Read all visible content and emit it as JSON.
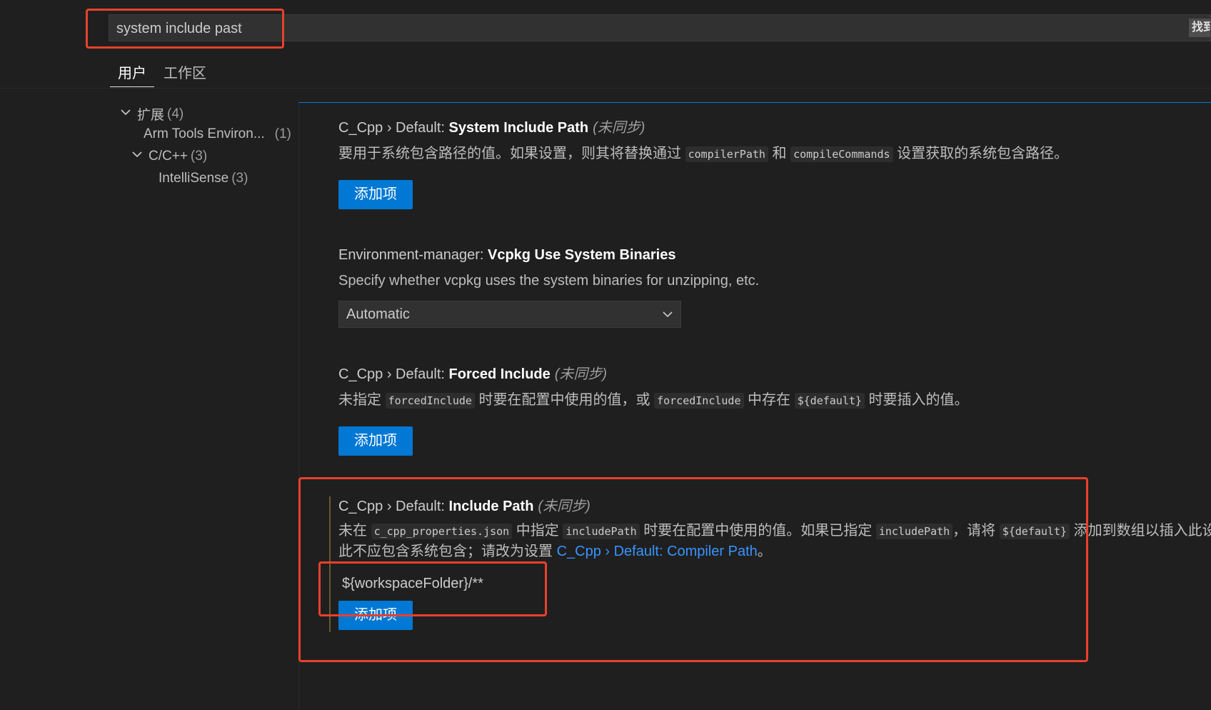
{
  "search": {
    "query": "system include past",
    "find_label": "找到"
  },
  "tabs": {
    "user": "用户",
    "workspace": "工作区"
  },
  "toc": {
    "ext_label": "扩展",
    "ext_count": "(4)",
    "arm_label": "Arm Tools Environ...",
    "arm_count": "(1)",
    "cpp_label": "C/C++",
    "cpp_count": "(3)",
    "intellisense_label": "IntelliSense",
    "intellisense_count": "(3)"
  },
  "settings": {
    "system_include": {
      "category": "C_Cpp › Default: ",
      "name": "System Include Path",
      "modified": "(未同步)",
      "desc_1": "要用于系统包含路径的值。如果设置，则其将替换通过 ",
      "code_1": "compilerPath",
      "desc_2": " 和 ",
      "code_2": "compileCommands",
      "desc_3": " 设置获取的系统包含路径。",
      "button": "添加项"
    },
    "vcpkg": {
      "category": "Environment-manager: ",
      "name": "Vcpkg Use System Binaries",
      "desc": "Specify whether vcpkg uses the system binaries for unzipping, etc.",
      "selected": "Automatic"
    },
    "forced_include": {
      "category": "C_Cpp › Default: ",
      "name": "Forced Include",
      "modified": "(未同步)",
      "desc_1": "未指定 ",
      "code_1": "forcedInclude",
      "desc_2": " 时要在配置中使用的值，或 ",
      "code_2": "forcedInclude",
      "desc_3": " 中存在 ",
      "code_3": "${default}",
      "desc_4": " 时要插入的值。",
      "button": "添加项"
    },
    "include_path": {
      "category": "C_Cpp › Default: ",
      "name": "Include Path",
      "modified": "(未同步)",
      "desc_1": "未在 ",
      "code_1": "c_cpp_properties.json",
      "desc_2": " 中指定 ",
      "code_2": "includePath",
      "desc_3": " 时要在配置中使用的值。如果已指定 ",
      "code_3": "includePath",
      "desc_4": "，请将 ",
      "code_4": "${default}",
      "desc_5": " 添加到数组以插入此设置",
      "line2_1": "此不应包含系统包含；请改为设置 ",
      "link": "C_Cpp › Default: Compiler Path",
      "line2_2": "。",
      "value": "${workspaceFolder}/**",
      "button": "添加项"
    }
  },
  "colors": {
    "accent": "#0078d4",
    "annotation": "#e8412c",
    "link": "#3794ff"
  }
}
